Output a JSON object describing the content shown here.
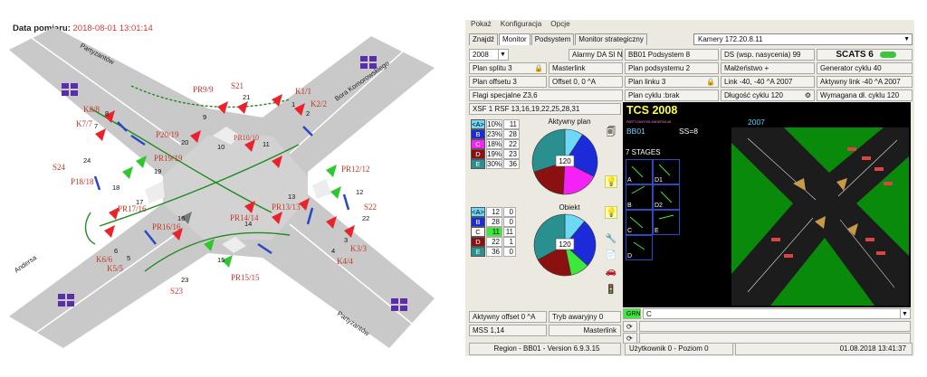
{
  "map": {
    "title_label": "Data pomiaru:",
    "title_datetime": "2018-08-01 13:01:14",
    "streets": {
      "nw": "Partyzantów",
      "ne": "Bora Komorowskiego",
      "sw": "Andersa",
      "se": "Partyzantów"
    },
    "signal_labels": [
      {
        "text": "K1/1"
      },
      {
        "text": "K2/2"
      },
      {
        "text": "K3/3"
      },
      {
        "text": "K4/4"
      },
      {
        "text": "K5/5"
      },
      {
        "text": "K6/6"
      },
      {
        "text": "K7/7"
      },
      {
        "text": "K8/8"
      },
      {
        "text": "PR9/9"
      },
      {
        "text": "PR10/10"
      },
      {
        "text": "PR12/12"
      },
      {
        "text": "PR13/13"
      },
      {
        "text": "PR14/14"
      },
      {
        "text": "PR15/15"
      },
      {
        "text": "PR16/16"
      },
      {
        "text": "PR17/16"
      },
      {
        "text": "P18/18"
      },
      {
        "text": "PR19/19"
      },
      {
        "text": "P20/19"
      },
      {
        "text": "S21"
      },
      {
        "text": "S22"
      },
      {
        "text": "S23"
      },
      {
        "text": "S24"
      }
    ],
    "number_labels": [
      "1",
      "2",
      "3",
      "4",
      "5",
      "6",
      "7",
      "8",
      "9",
      "10",
      "11",
      "12",
      "13",
      "14",
      "15",
      "16",
      "17",
      "18",
      "19",
      "20",
      "21",
      "22",
      "23",
      "24"
    ]
  },
  "window": {
    "menu": [
      "Pokaż",
      "Konfiguracja",
      "Opcje"
    ],
    "tabs": [
      "Znajdź",
      "Monitor",
      "Podsystem",
      "Monitor strategiczny"
    ],
    "camera": "Kamery 172.20.8.11",
    "year_select": "2008",
    "alarm": "Alarmy DA SI NF",
    "subsystem": "BB01 Podsystem 8",
    "ds": "DS (wsp. nasycenia) 99",
    "scats": "SCATS 6",
    "plan_split": "Plan splitu 3",
    "masterlink_top": "Masterlink",
    "plan_subsystem": "Plan podsystemu 2",
    "marriage": "Małżeństwo +",
    "cycle_gen": "Generator cyklu 40",
    "plan_offset": "Plan offsetu 3",
    "offset": "Offset 0, 0 ^A",
    "plan_link": "Plan linku 3",
    "link": "Link -40, -40 ^A 2007",
    "active_link": "Aktywny link -40 ^A 2007",
    "special_flags": "Flagi specjalne Z3,6",
    "cycle_plan": "Plan cyklu :brak",
    "cycle_len": "Długość cyklu 120",
    "req_cycle": "Wymagana dł. cyklu 120",
    "xsf": "XSF 1 RSF 13,16,19,22,25,28,31",
    "active_plan_title": "Aktywny plan",
    "object_title": "Obiekt",
    "pie_center_1": "120",
    "pie_center_2": "120",
    "active_offset": "Aktywny offset 0 ^A",
    "emergency": "Tryb awaryjny 0",
    "mss": "MSS  1,14",
    "masterlink_bottom": "Masterlink",
    "grn_label": "GRN",
    "grn_value": "C",
    "status_region": "Region - BB01 - Version 6.9.3.15",
    "status_user": "Użytkownik 0 - Poziom 0",
    "status_time": "01.08.2018  13:41:37"
  },
  "plan_table": [
    {
      "key": "<A>",
      "pct": "10%",
      "val": "11",
      "color": "#6ed8f7"
    },
    {
      "key": "B",
      "pct": "23%",
      "val": "28",
      "color": "#1c2bd9"
    },
    {
      "key": "C",
      "pct": "18%",
      "val": "22",
      "color": "#f522f5"
    },
    {
      "key": "D",
      "pct": "19%",
      "val": "23",
      "color": "#8b1111"
    },
    {
      "key": "E",
      "pct": "30%",
      "val": "36",
      "color": "#2a8f8f"
    }
  ],
  "object_table": [
    {
      "key": "<A>",
      "v1": "12",
      "v2": "0",
      "color": "#6ed8f7",
      "v1bg": "#ffffff"
    },
    {
      "key": "B",
      "v1": "28",
      "v2": "0",
      "color": "#1c2bd9",
      "v1bg": "#ffffff"
    },
    {
      "key": "C",
      "v1": "11",
      "v2": "11",
      "color": "#ffffff",
      "v1bg": "#3be83b"
    },
    {
      "key": "D",
      "v1": "22",
      "v2": "1",
      "color": "#8b1111",
      "v1bg": "#ffffff"
    },
    {
      "key": "E",
      "v1": "36",
      "v2": "0",
      "color": "#2a8f8f",
      "v1bg": "#ffffff"
    }
  ],
  "tcs": {
    "title": "TCS 2008",
    "sub": "PARTYZANTOW-ANDERSA  #8",
    "bb": "BB01",
    "ss": "SS=8",
    "stages_label": "7 STAGES",
    "stages": [
      "A",
      "B",
      "C",
      "D",
      "E",
      "D1",
      "D2",
      "D",
      "E"
    ],
    "cam_year": "2007"
  },
  "colors": {
    "red": "#e8232a",
    "green": "#2ec82e",
    "blue": "#2b47c8",
    "road": "#c9c9c9"
  }
}
